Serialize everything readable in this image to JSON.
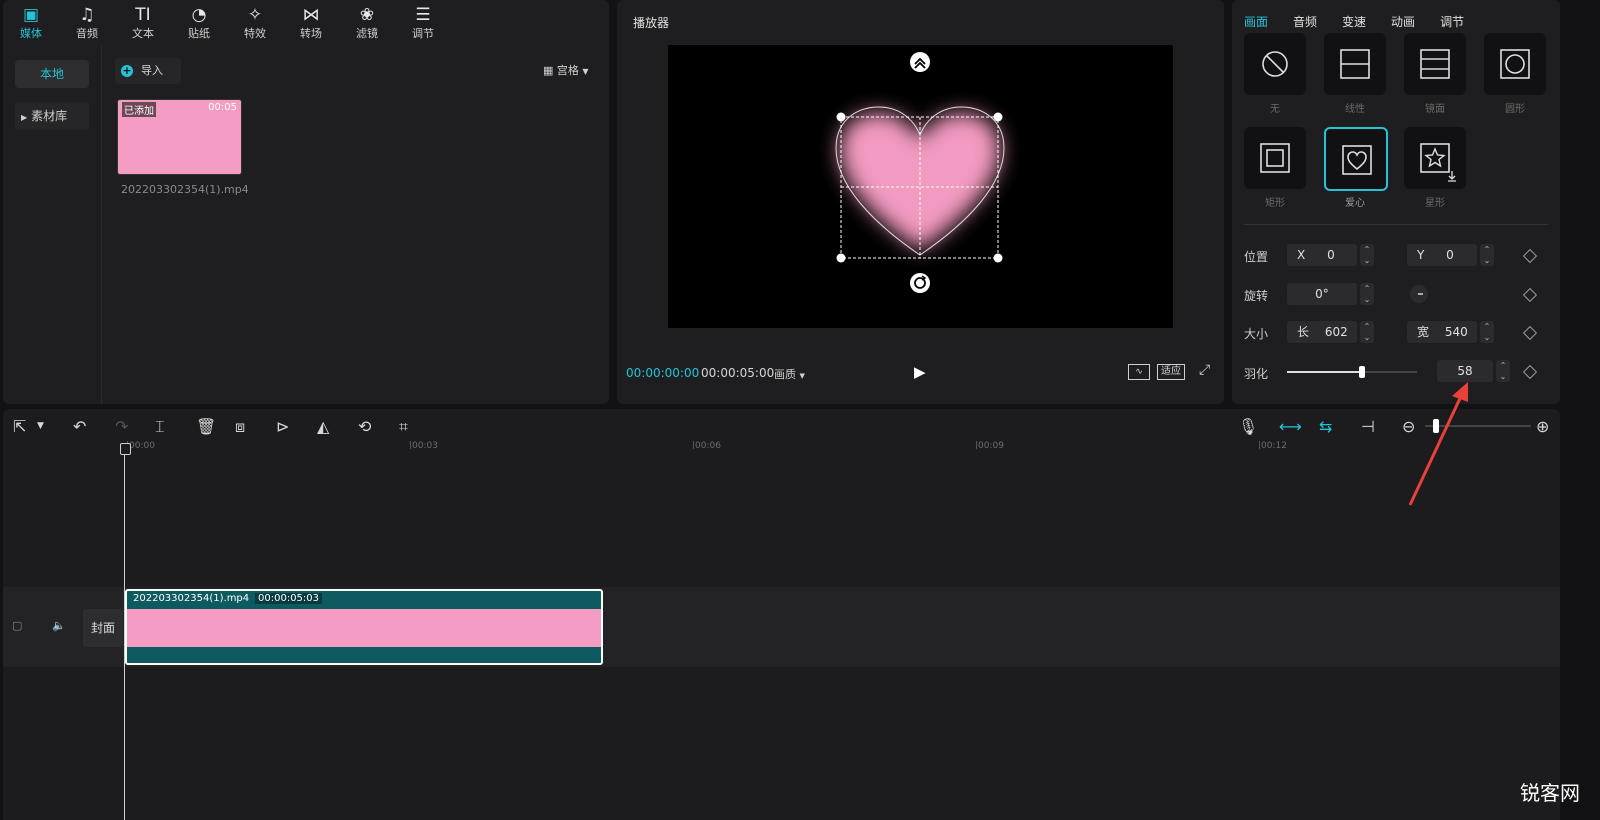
{
  "media_panel": {
    "tabs": [
      {
        "label": "媒体",
        "icon": "play-square-icon",
        "glyph": "▣"
      },
      {
        "label": "音频",
        "icon": "music-note-icon",
        "glyph": "♫"
      },
      {
        "label": "文本",
        "icon": "text-icon",
        "glyph": "TI"
      },
      {
        "label": "贴纸",
        "icon": "sticker-icon",
        "glyph": "◔"
      },
      {
        "label": "特效",
        "icon": "sparkle-icon",
        "glyph": "✧"
      },
      {
        "label": "转场",
        "icon": "transition-icon",
        "glyph": "⋈"
      },
      {
        "label": "滤镜",
        "icon": "filter-icon",
        "glyph": "❀"
      },
      {
        "label": "调节",
        "icon": "sliders-icon",
        "glyph": "☰"
      }
    ],
    "side": {
      "local": "本地",
      "library": "素材库"
    },
    "import_label": "导入",
    "grid_label": "宫格",
    "thumb": {
      "added": "已添加",
      "duration": "00:05",
      "filename": "202203302354(1).mp4"
    }
  },
  "player": {
    "title": "播放器",
    "current_time": "00:00:00:00",
    "total_time": "00:00:05:00",
    "ratio_label": "画质",
    "fit_label": "适应"
  },
  "props": {
    "tabs": [
      "画面",
      "音频",
      "变速",
      "动画",
      "调节"
    ],
    "masks": [
      {
        "label": "无",
        "icon": "none-mask-icon"
      },
      {
        "label": "线性",
        "icon": "linear-mask-icon"
      },
      {
        "label": "镜面",
        "icon": "mirror-mask-icon"
      },
      {
        "label": "圆形",
        "icon": "circle-mask-icon"
      },
      {
        "label": "矩形",
        "icon": "rect-mask-icon"
      },
      {
        "label": "爱心",
        "icon": "heart-mask-icon"
      },
      {
        "label": "星形",
        "icon": "star-mask-icon"
      }
    ],
    "position": {
      "label": "位置",
      "x_label": "X",
      "x": "0",
      "y_label": "Y",
      "y": "0"
    },
    "rotation": {
      "label": "旋转",
      "value": "0°"
    },
    "size": {
      "label": "大小",
      "w_label": "长",
      "w": "602",
      "h_label": "宽",
      "h": "540"
    },
    "feather": {
      "label": "羽化",
      "value": "58",
      "fraction": 0.58
    }
  },
  "timeline": {
    "ruler": [
      "00:00",
      "00:03",
      "00:06",
      "00:09",
      "00:12"
    ],
    "clip": {
      "name": "202203302354(1).mp4",
      "duration": "00:00:05:03"
    },
    "cover_label": "封面"
  },
  "watermark": "锐客网",
  "colors": {
    "accent": "#25c3d6",
    "clip_pink": "#f39dc2",
    "clip_bg": "#0d5a60",
    "arrow": "#e8413a"
  }
}
